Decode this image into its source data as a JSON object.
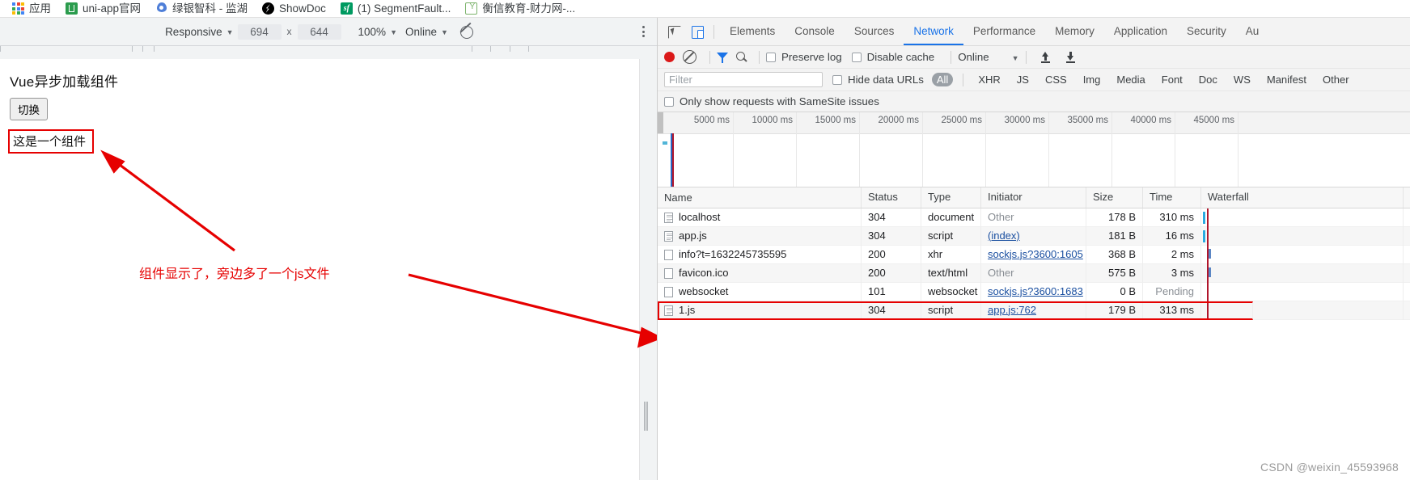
{
  "bookmarks": [
    {
      "label": "应用",
      "icon": "apps-grid-icon"
    },
    {
      "label": "uni-app官网",
      "icon": "uniapp-icon"
    },
    {
      "label": "绿银智科 - 监湖",
      "icon": "location-pin-icon"
    },
    {
      "label": "ShowDoc",
      "icon": "showdoc-icon"
    },
    {
      "label": "(1) SegmentFault...",
      "icon": "segmentfault-icon"
    },
    {
      "label": "衡信教育-财力网-...",
      "icon": "hengxin-icon"
    }
  ],
  "device_toolbar": {
    "device_label": "Responsive",
    "width": "694",
    "height": "644",
    "times": "x",
    "zoom": "100%",
    "throttle": "Online",
    "rotate_icon": "rotate-icon",
    "menu_icon": "kebab-menu-icon"
  },
  "page": {
    "heading": "Vue异步加载组件",
    "toggle_button": "切换",
    "component_text": "这是一个组件",
    "annotation": "组件显示了，旁边多了一个js文件"
  },
  "devtools": {
    "tools": [
      {
        "name": "inspect-element-icon"
      },
      {
        "name": "toggle-device-toolbar-icon"
      }
    ],
    "tabs": [
      {
        "label": "Elements",
        "active": false
      },
      {
        "label": "Console",
        "active": false
      },
      {
        "label": "Sources",
        "active": false
      },
      {
        "label": "Network",
        "active": true
      },
      {
        "label": "Performance",
        "active": false
      },
      {
        "label": "Memory",
        "active": false
      },
      {
        "label": "Application",
        "active": false
      },
      {
        "label": "Security",
        "active": false
      },
      {
        "label": "Au",
        "active": false
      }
    ],
    "toolbar": {
      "record_icon": "record-button",
      "clear_icon": "clear-icon",
      "filter_icon": "filter-funnel-icon",
      "search_icon": "search-icon",
      "preserve_log": "Preserve log",
      "disable_cache": "Disable cache",
      "throttle": "Online",
      "import_icon": "import-har-icon",
      "export_icon": "export-har-icon"
    },
    "filterbar": {
      "placeholder": "Filter",
      "hide_data_urls": "Hide data URLs",
      "types": [
        "All",
        "XHR",
        "JS",
        "CSS",
        "Img",
        "Media",
        "Font",
        "Doc",
        "WS",
        "Manifest",
        "Other"
      ],
      "active_type": "All"
    },
    "samesite": "Only show requests with SameSite issues",
    "overview": {
      "ticks": [
        "5000 ms",
        "10000 ms",
        "15000 ms",
        "20000 ms",
        "25000 ms",
        "30000 ms",
        "35000 ms",
        "40000 ms",
        "45000 ms"
      ]
    },
    "table": {
      "columns": [
        "Name",
        "Status",
        "Type",
        "Initiator",
        "Size",
        "Time",
        "Waterfall"
      ],
      "rows": [
        {
          "name": "localhost",
          "status": "304",
          "type": "document",
          "initiator": "Other",
          "initiator_link": false,
          "size": "178 B",
          "time": "310 ms",
          "icon": "document-file-icon",
          "wf_color": "#2aa9e0",
          "wf_left": "2",
          "wf_h": "15"
        },
        {
          "name": "app.js",
          "status": "304",
          "type": "script",
          "initiator": "(index)",
          "initiator_link": true,
          "size": "181 B",
          "time": "16 ms",
          "icon": "document-file-icon",
          "wf_color": "#2aa9e0",
          "wf_left": "2",
          "wf_h": "15"
        },
        {
          "name": "info?t=1632245735595",
          "status": "200",
          "type": "xhr",
          "initiator": "sockjs.js?3600:1605",
          "initiator_link": true,
          "size": "368 B",
          "time": "2 ms",
          "icon": "blank-file-icon",
          "wf_color": "#5b86c4",
          "wf_left": "9",
          "wf_h": "12"
        },
        {
          "name": "favicon.ico",
          "status": "200",
          "type": "text/html",
          "initiator": "Other",
          "initiator_link": false,
          "size": "575 B",
          "time": "3 ms",
          "icon": "blank-file-icon",
          "wf_color": "#5b86c4",
          "wf_left": "9",
          "wf_h": "12"
        },
        {
          "name": "websocket",
          "status": "101",
          "type": "websocket",
          "initiator": "sockjs.js?3600:1683",
          "initiator_link": true,
          "size": "0 B",
          "time": "Pending",
          "time_muted": true,
          "icon": "blank-file-icon",
          "wf_color": "",
          "wf_left": "9",
          "wf_h": "0"
        },
        {
          "name": "1.js",
          "status": "304",
          "type": "script",
          "initiator": "app.js:762",
          "initiator_link": true,
          "size": "179 B",
          "time": "313 ms",
          "icon": "document-file-icon",
          "wf_color": "",
          "wf_left": "9",
          "wf_h": "0",
          "highlighted": true
        }
      ]
    }
  },
  "watermark": "CSDN @weixin_45593968",
  "colors": {
    "accent": "#1a73e8",
    "annotation_red": "#e60000",
    "record_red": "#db1919",
    "link": "#1a4fa0"
  }
}
